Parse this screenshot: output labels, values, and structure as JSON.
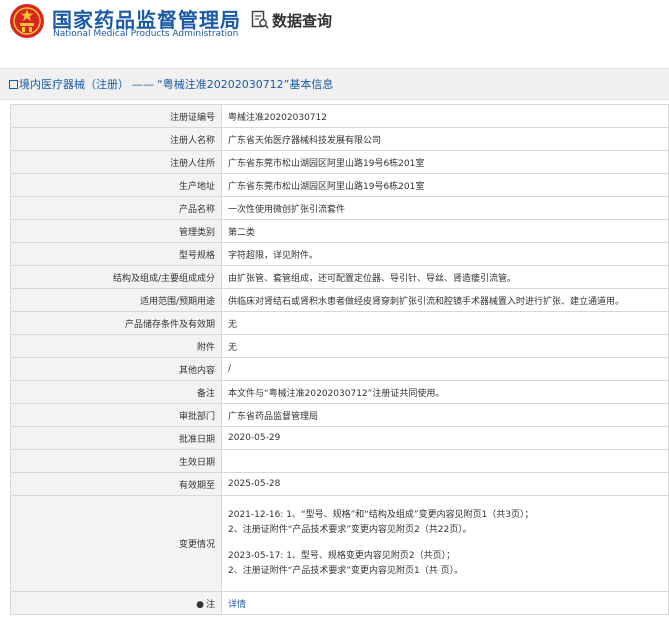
{
  "header": {
    "logo_cn": "国家药品监督管理局",
    "logo_en": "National Medical Products Administration",
    "query_label": "数据查询",
    "brand_color": "#1a5aa8"
  },
  "page_title": {
    "prefix": "境内医疗器械（注册）",
    "dash": "——",
    "subject": "“粤械注准20202030712”",
    "suffix": "基本信息"
  },
  "rows": [
    {
      "key": "注册证编号",
      "value": "粤械注准20202030712"
    },
    {
      "key": "注册人名称",
      "value": "广东省天佑医疗器械科技发展有限公司"
    },
    {
      "key": "注册人住所",
      "value": "广东省东莞市松山湖园区阿里山路19号6栋201室"
    },
    {
      "key": "生产地址",
      "value": "广东省东莞市松山湖园区阿里山路19号6栋201室"
    },
    {
      "key": "产品名称",
      "value": "一次性使用微创扩张引流套件"
    },
    {
      "key": "管理类别",
      "value": "第二类"
    },
    {
      "key": "型号规格",
      "value": "字符超限，详见附件。"
    },
    {
      "key": "结构及组成/主要组成成分",
      "value": "由扩张管、套管组成，还可配置定位器、导引针、导丝、肾造瘘引流管。"
    },
    {
      "key": "适用范围/预期用途",
      "value": "供临床对肾结石或肾积水患者做经皮肾穿刺扩张引流和腔镜手术器械置入时进行扩张、建立通道用。"
    },
    {
      "key": "产品储存条件及有效期",
      "value": "无"
    },
    {
      "key": "附件",
      "value": "无"
    },
    {
      "key": "其他内容",
      "value": "/"
    },
    {
      "key": "备注",
      "value": "本文件与“粤械注准20202030712”注册证共同使用。"
    },
    {
      "key": "审批部门",
      "value": "广东省药品监督管理局"
    },
    {
      "key": "批准日期",
      "value": "2020-05-29"
    },
    {
      "key": "生效日期",
      "value": ""
    },
    {
      "key": "有效期至",
      "value": "2025-05-28"
    }
  ],
  "changes": {
    "key": "变更情况",
    "lines_a": [
      "2021-12-16: 1、“型号、规格”和“结构及组成”变更内容见附页1（共3页）；",
      "2、注册证附件“产品技术要求”变更内容见附页2（共22页）。"
    ],
    "lines_b": [
      "2023-05-17: 1、型号、规格变更内容见附页2（共页）；",
      "2、注册证附件“产品技术要求”变更内容见附页1（共 页）。"
    ]
  },
  "note_row": {
    "key": "注",
    "link_label": "详情"
  }
}
